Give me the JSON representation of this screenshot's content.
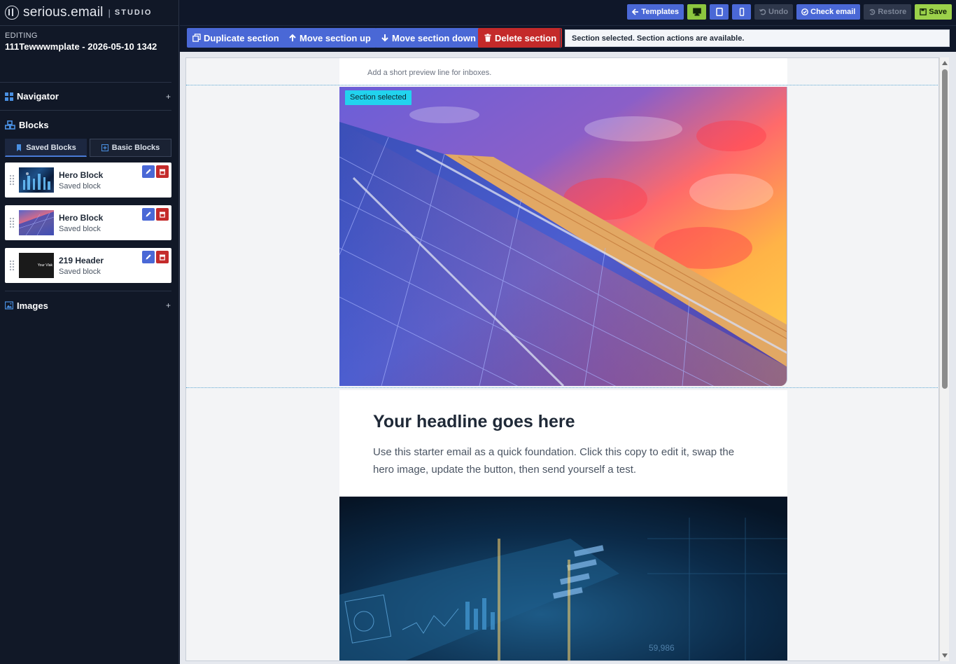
{
  "brand": {
    "name": "serious.email",
    "separator": "|",
    "product": "STUDIO"
  },
  "editing": {
    "label": "EDITING",
    "name": "111Tewwwmplate - 2026-05-10 1342"
  },
  "navigator": {
    "label": "Navigator",
    "toggle": "+"
  },
  "blocks": {
    "label": "Blocks",
    "tabs": [
      {
        "label": "Saved Blocks",
        "active": true
      },
      {
        "label": "Basic Blocks",
        "active": false
      }
    ],
    "items": [
      {
        "title": "Hero Block",
        "subtitle": "Saved block"
      },
      {
        "title": "Hero Block",
        "subtitle": "Saved block"
      },
      {
        "title": "219 Header",
        "subtitle": "Saved block",
        "thumb_text": "Your Vlak"
      }
    ]
  },
  "images": {
    "label": "Images",
    "toggle": "+"
  },
  "toolbar": {
    "templates": "Templates",
    "undo": "Undo",
    "check_email": "Check email",
    "restore": "Restore",
    "save": "Save"
  },
  "section_actions": {
    "duplicate": "Duplicate section",
    "move_up": "Move section up",
    "move_down": "Move section down",
    "delete": "Delete section",
    "status": "Section selected. Section actions are available."
  },
  "canvas": {
    "preview_line": "Add a short preview line for inboxes.",
    "selected_badge": "Section selected",
    "headline": "Your headline goes here",
    "body": "Use this starter email as a quick foundation. Click this copy to edit it, swap the hero image, update the button, then send yourself a test.",
    "hud_readout": "59,986"
  },
  "colors": {
    "accent": "#4a68d6",
    "danger": "#c42a2a",
    "save": "#9bd14a",
    "selection": "#22d3ee",
    "sidebar_bg": "#111827"
  }
}
